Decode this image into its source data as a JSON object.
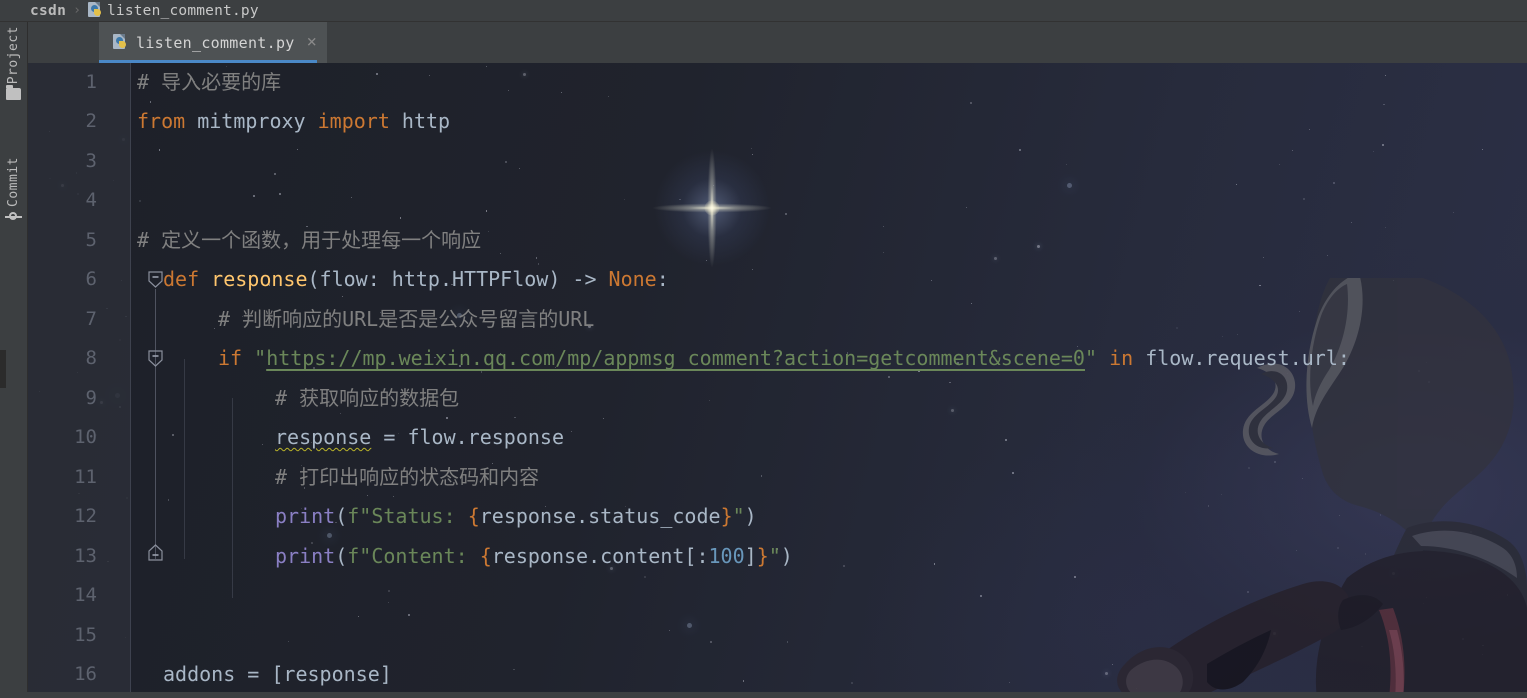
{
  "window": {
    "theme_name": "Darcula",
    "editor_bg": "#1f222b",
    "chrome_bg": "#3c3f41"
  },
  "breadcrumb": {
    "project_label": "csdn",
    "separator": "›",
    "file_label": "listen_comment.py",
    "file_icon": "python-file-icon"
  },
  "tool_strip": {
    "items": [
      {
        "label": "Project",
        "icon": "folder-icon"
      },
      {
        "label": "Commit",
        "icon": "commit-icon"
      }
    ]
  },
  "tabs": {
    "items": [
      {
        "label": "listen_comment.py",
        "icon": "python-file-icon",
        "close_label": "×",
        "active": true
      }
    ]
  },
  "editor": {
    "language": "Python",
    "accent_color": "#4a88c7",
    "syntax_colors": {
      "keyword": "#cc7832",
      "function": "#ffc66d",
      "identifier": "#a9b7c6",
      "comment": "#808080",
      "string": "#6a8759",
      "number": "#6897bb",
      "builtin": "#8a7fc4",
      "warning_underline": "#bbb529",
      "line_number": "#5d626e"
    },
    "lines": [
      {
        "n": "1",
        "code": "# 导入必要的库"
      },
      {
        "n": "2",
        "code": "from mitmproxy import http"
      },
      {
        "n": "3",
        "code": ""
      },
      {
        "n": "4",
        "code": ""
      },
      {
        "n": "5",
        "code": "# 定义一个函数，用于处理每一个响应"
      },
      {
        "n": "6",
        "code": "def response(flow: http.HTTPFlow) -> None:"
      },
      {
        "n": "7",
        "code": "    # 判断响应的URL是否是公众号留言的URL"
      },
      {
        "n": "8",
        "code": "    if \"https://mp.weixin.qq.com/mp/appmsg_comment?action=getcomment&scene=0\" in flow.request.url:"
      },
      {
        "n": "9",
        "code": "        # 获取响应的数据包"
      },
      {
        "n": "10",
        "code": "        response = flow.response"
      },
      {
        "n": "11",
        "code": "        # 打印出响应的状态码和内容"
      },
      {
        "n": "12",
        "code": "        print(f\"Status: {response.status_code}\")"
      },
      {
        "n": "13",
        "code": "        print(f\"Content: {response.content[:100]}\")"
      },
      {
        "n": "14",
        "code": ""
      },
      {
        "n": "15",
        "code": ""
      },
      {
        "n": "16",
        "code": "addons = [response]"
      }
    ],
    "tokens": {
      "comment_line1": "# 导入必要的库",
      "kw_from": "from",
      "mod_mitmproxy": " mitmproxy ",
      "kw_import": "import",
      "mod_http": " http",
      "comment_line5": "# 定义一个函数，用于处理每一个响应",
      "kw_def": "def",
      "fn_response": "response",
      "sig_params": "(flow: http.HTTPFlow) ",
      "arrow": "-> ",
      "kw_none": "None",
      "colon": ":",
      "comment_line7": "# 判断响应的URL是否是公众号留言的URL",
      "kw_if": "if",
      "quote": "\"",
      "url_string": "https://mp.weixin.qq.com/mp/appmsg_comment?action=getcomment&scene=0",
      "kw_in": "in",
      "expr_flow_url": " flow.request.url:",
      "comment_line9": "# 获取响应的数据包",
      "var_response": "response",
      "assign_flow_response": " = flow.response",
      "comment_line11": "# 打印出响应的状态码和内容",
      "builtin_print": "print",
      "paren_open": "(",
      "fstr_prefix_status": "f\"Status: ",
      "brace_open": "{",
      "expr_status_code": "response.status_code",
      "brace_close": "}",
      "fstr_suffix": "\"",
      "paren_close": ")",
      "fstr_prefix_content": "f\"Content: ",
      "expr_content_head": "response.content[:",
      "num_100": "100",
      "expr_content_tail": "]",
      "var_addons": "addons",
      "assign_addons": " = [",
      "addons_value": "response",
      "bracket_close": "]"
    },
    "gutter": {
      "fold_markers": [
        {
          "line": "6",
          "state": "expanded",
          "glyph": "minus"
        },
        {
          "line": "8",
          "state": "expanded",
          "glyph": "minus"
        },
        {
          "line": "13",
          "state": "end",
          "glyph": "minus"
        }
      ]
    }
  }
}
